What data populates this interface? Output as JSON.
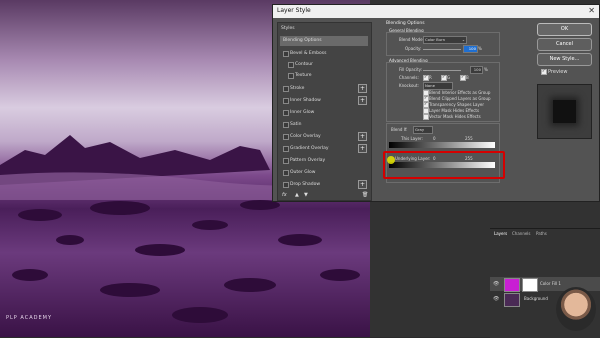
{
  "dialog": {
    "title": "Layer Style",
    "close_glyph": "✕",
    "styles_header": "Styles",
    "styles": [
      {
        "label": "Blending Options",
        "checkbox": false,
        "plus": false,
        "selected": true
      },
      {
        "label": "Bevel & Emboss",
        "checkbox": true,
        "plus": false
      },
      {
        "label": "Contour",
        "checkbox": true,
        "plus": false,
        "indent": true
      },
      {
        "label": "Texture",
        "checkbox": true,
        "plus": false,
        "indent": true
      },
      {
        "label": "Stroke",
        "checkbox": true,
        "plus": true
      },
      {
        "label": "Inner Shadow",
        "checkbox": true,
        "plus": true
      },
      {
        "label": "Inner Glow",
        "checkbox": true,
        "plus": false
      },
      {
        "label": "Satin",
        "checkbox": true,
        "plus": false
      },
      {
        "label": "Color Overlay",
        "checkbox": true,
        "plus": true
      },
      {
        "label": "Gradient Overlay",
        "checkbox": true,
        "plus": true
      },
      {
        "label": "Pattern Overlay",
        "checkbox": true,
        "plus": false
      },
      {
        "label": "Outer Glow",
        "checkbox": true,
        "plus": false
      },
      {
        "label": "Drop Shadow",
        "checkbox": true,
        "plus": true
      }
    ],
    "fx_footer": "fx",
    "blending": {
      "section": "Blending Options",
      "general": "General Blending",
      "blend_mode_label": "Blend Mode:",
      "blend_mode_value": "Color Burn",
      "opacity_label": "Opacity:",
      "opacity_value": "100",
      "opacity_unit": "%",
      "advanced": "Advanced Blending",
      "fill_label": "Fill Opacity:",
      "fill_value": "100",
      "fill_unit": "%",
      "channels_label": "Channels:",
      "channels": [
        "R",
        "G",
        "B"
      ],
      "knockout_label": "Knockout:",
      "knockout_value": "None",
      "options": [
        {
          "label": "Blend Interior Effects as Group",
          "checked": false
        },
        {
          "label": "Blend Clipped Layers as Group",
          "checked": true
        },
        {
          "label": "Transparency Shapes Layer",
          "checked": true
        },
        {
          "label": "Layer Mask Hides Effects",
          "checked": false
        },
        {
          "label": "Vector Mask Hides Effects",
          "checked": false
        }
      ],
      "blend_if_label": "Blend If:",
      "blend_if_value": "Gray",
      "this_layer_label": "This Layer:",
      "this_layer_low": "0",
      "this_layer_high": "255",
      "underlying_label": "Underlying Layer:",
      "underlying_low": "0",
      "underlying_high": "255"
    },
    "buttons": {
      "ok": "OK",
      "cancel": "Cancel",
      "new_style": "New Style...",
      "preview": "Preview"
    }
  },
  "layers_panel": {
    "tabs": [
      "Layers",
      "Channels",
      "Paths"
    ],
    "layers": [
      {
        "name": "Color Fill 1",
        "thumb_color": "#c81fd3"
      },
      {
        "name": "Background",
        "thumb_color": "#6a6a6a"
      }
    ]
  },
  "watermark": "PLP ACADEMY",
  "colors": {
    "highlight_box": "#d40000",
    "cursor": "#e6e600"
  }
}
